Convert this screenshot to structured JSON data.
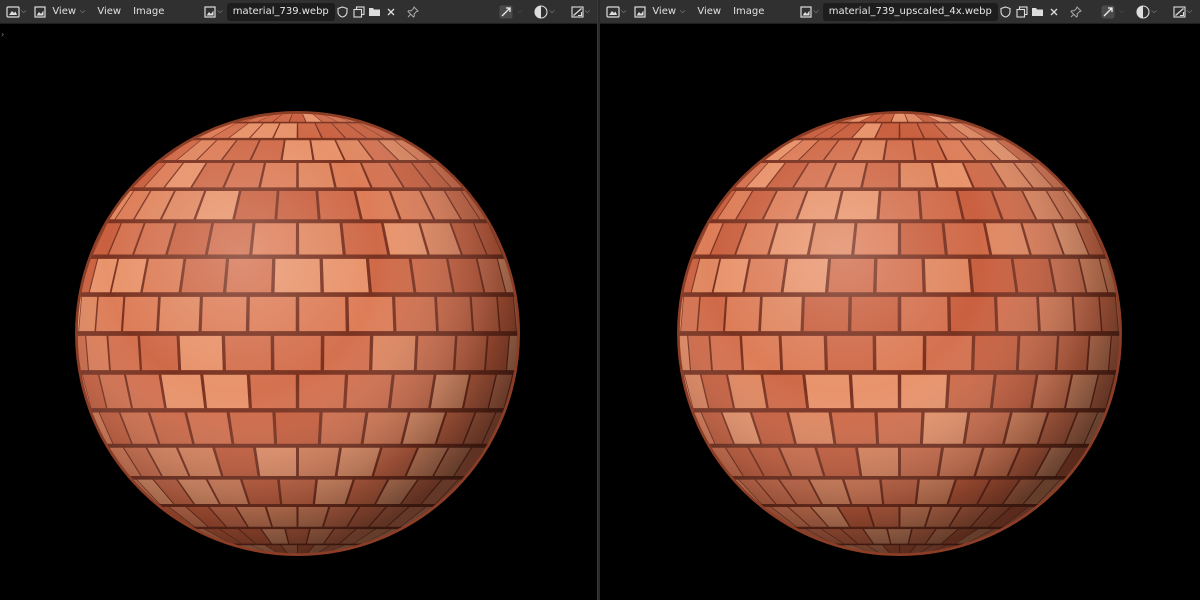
{
  "editors": [
    {
      "menu_view": "View",
      "menu_view2": "View",
      "menu_image": "Image",
      "image_name": "material_739.webp"
    },
    {
      "menu_view": "View",
      "menu_view2": "View",
      "menu_image": "Image",
      "image_name": "material_739_upscaled_4x.webp"
    }
  ],
  "icons": {
    "editor_type": "image-editor-icon",
    "image_browse": "image-browse-icon",
    "fake_user": "shield-icon",
    "duplicate": "duplicate-icon",
    "open": "folder-icon",
    "unlink": "close-icon",
    "pin": "pin-icon",
    "gizmo": "gizmo-icon",
    "display_channels": "display-channels-icon",
    "view_mode": "view-mode-icon"
  },
  "colors": {
    "header_bg": "#303030",
    "viewport_bg": "#000000",
    "brick": "#d4714f",
    "mortar": "#7a3220"
  }
}
